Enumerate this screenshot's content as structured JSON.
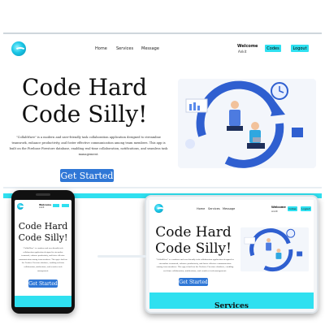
{
  "desktop": {
    "nav": {
      "home": "Home",
      "services": "Services",
      "message": "Message",
      "welcome": "Welcome",
      "user": "Ankit",
      "codes": "Codes",
      "logout": "Logout"
    },
    "hero": {
      "line1": "Code Hard",
      "line2": "Code Silly!",
      "description": "\"CollabWave\" is a modern and user-friendly task collaboration application designed to streamline teamwork, enhance productivity, and foster effective communication among team members. This app is built on the Firebase Firestore database, enabling real-time collaboration, notifications, and seamless task management.",
      "cta": "Get Started"
    }
  },
  "tablet": {
    "nav": {
      "home": "Home",
      "services": "Services",
      "message": "Message",
      "welcome": "Welcome",
      "user": "Ankit",
      "codes": "Codes",
      "logout": "Logout"
    },
    "hero": {
      "line1": "Code Hard",
      "line2": "Code Silly!",
      "cta": "Get Started"
    },
    "section_heading": "Services"
  },
  "phone": {
    "nav": {
      "welcome": "Welcome",
      "user": "Ankit"
    },
    "hero": {
      "line1": "Code Hard",
      "line2": "Code Silly!",
      "cta": "Get Started"
    }
  },
  "colors": {
    "accent": "#2fe0f0",
    "primary": "#2f77d6",
    "dark": "#1c1c1c"
  }
}
